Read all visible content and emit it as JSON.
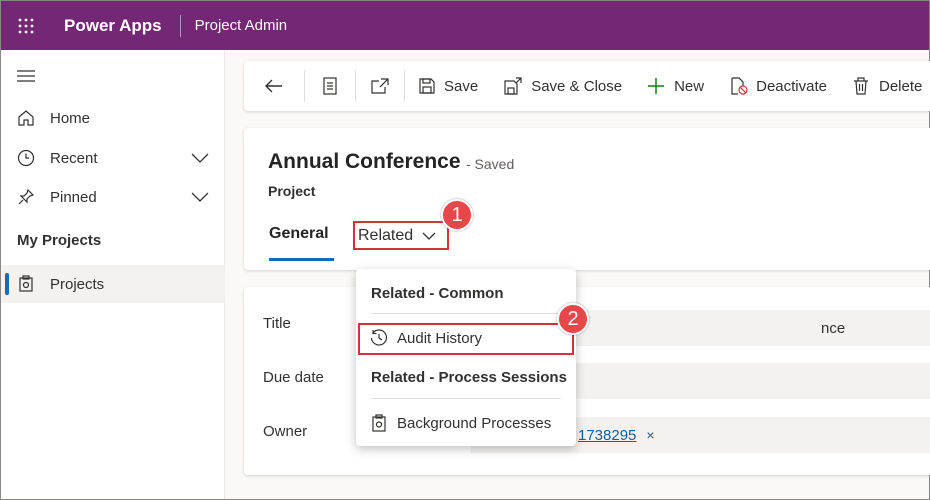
{
  "topbar": {
    "app_name": "Power Apps",
    "environment": "Project Admin",
    "bg_color": "#742774"
  },
  "sidenav": {
    "items": [
      {
        "label": "Home",
        "icon": "home-icon"
      },
      {
        "label": "Recent",
        "icon": "clock-icon"
      },
      {
        "label": "Pinned",
        "icon": "pin-icon"
      }
    ],
    "section_title": "My Projects",
    "section_items": [
      {
        "label": "Projects",
        "icon": "project-icon",
        "selected": true
      }
    ]
  },
  "command_bar": {
    "save": "Save",
    "save_close": "Save & Close",
    "new": "New",
    "deactivate": "Deactivate",
    "delete": "Delete"
  },
  "record": {
    "title": "Annual Conference",
    "status": "- Saved",
    "entity": "Project",
    "tabs": {
      "general": "General",
      "related": "Related"
    }
  },
  "form": {
    "fields": [
      {
        "label": "Title",
        "value": "nce"
      },
      {
        "label": "Due date",
        "value": ""
      },
      {
        "label": "Owner",
        "value": "1738295",
        "remove": "×"
      }
    ]
  },
  "related_menu": {
    "common_header": "Related - Common",
    "audit_history": "Audit History",
    "process_header": "Related - Process Sessions",
    "background_processes": "Background Processes"
  },
  "callouts": {
    "one": "1",
    "two": "2",
    "color": "#e8474a"
  }
}
